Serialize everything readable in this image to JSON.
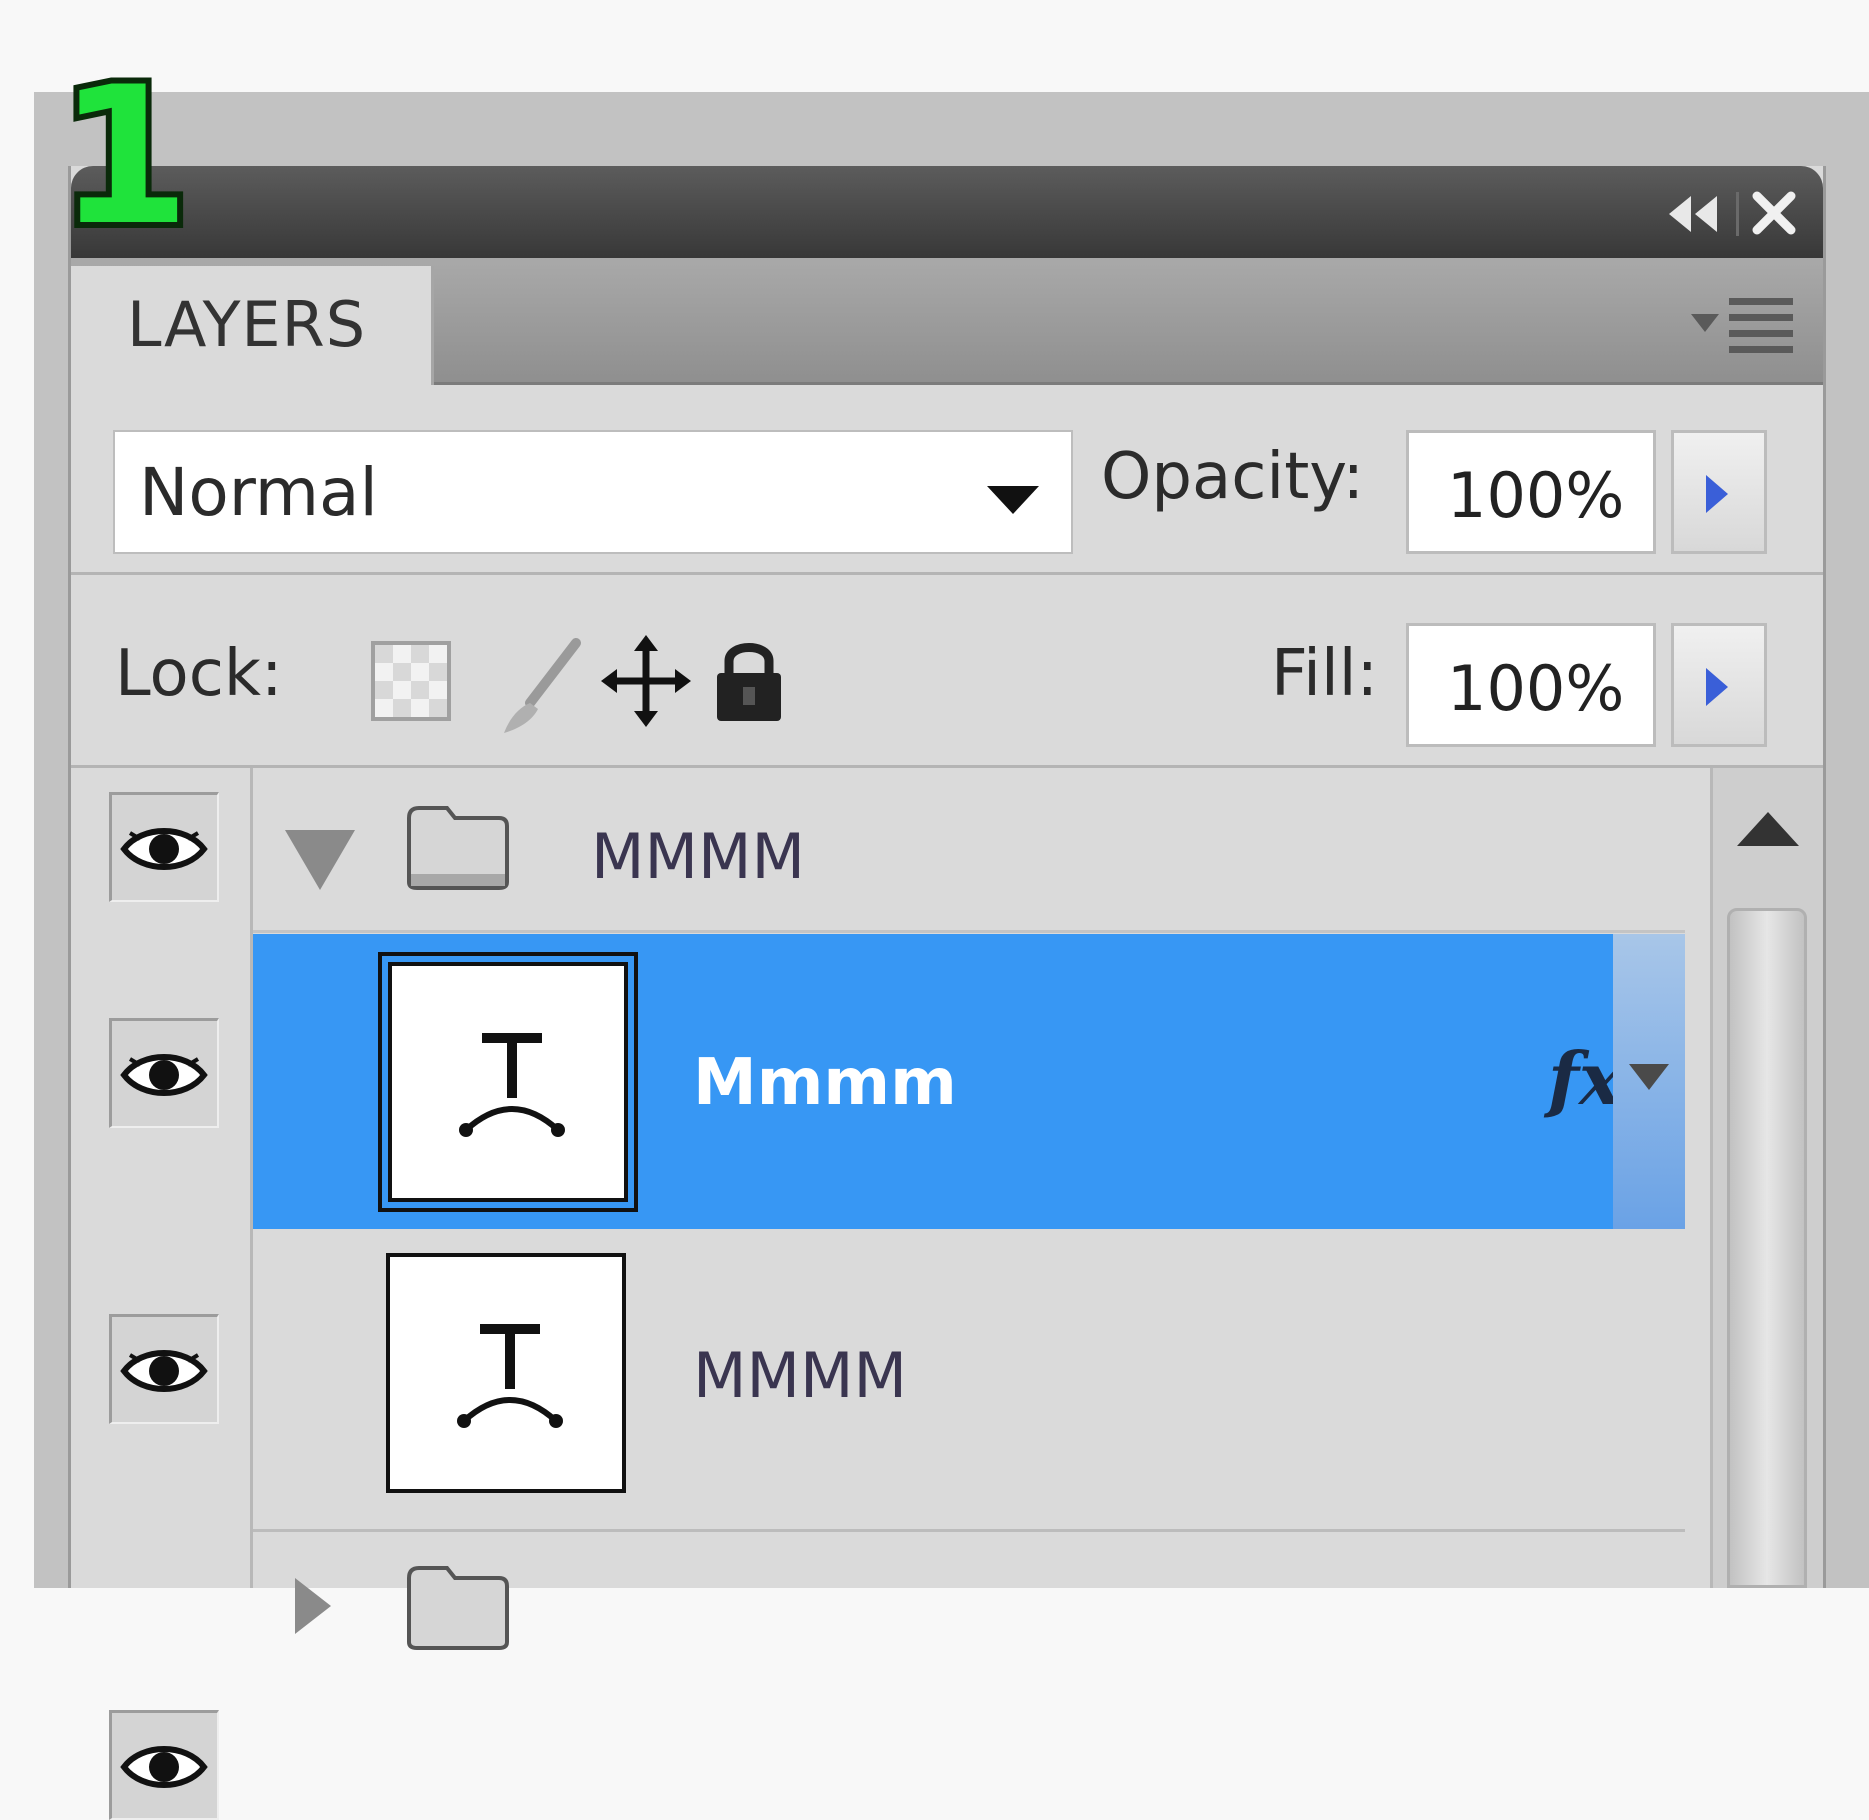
{
  "annotation": {
    "step_number": "1"
  },
  "panel": {
    "tab_label": "LAYERS",
    "blend_mode": {
      "selected": "Normal"
    },
    "opacity": {
      "label": "Opacity:",
      "value": "100%"
    },
    "lock": {
      "label": "Lock:"
    },
    "fill": {
      "label": "Fill:",
      "value": "100%"
    }
  },
  "layers": {
    "group": {
      "name": "MMMM",
      "expanded": true,
      "visible": true
    },
    "items": [
      {
        "name": "Mmmm",
        "type": "text",
        "selected": true,
        "visible": true,
        "has_effects": true,
        "effects_label": "fx"
      },
      {
        "name": "MMMM",
        "type": "text",
        "selected": false,
        "visible": true
      }
    ],
    "next_group": {
      "visible": true
    }
  },
  "colors": {
    "selection": "#3797f4",
    "badge_fill": "#1fe33b",
    "title_bar": "#444444",
    "panel_bg": "#dadada"
  },
  "icons": {
    "collapse": "double-chevron-left-icon",
    "close": "close-icon",
    "panel_menu": "panel-menu-icon",
    "eye": "eye-icon",
    "folder": "folder-icon",
    "text_layer": "text-layer-icon",
    "lock_transparency": "lock-transparency-icon",
    "lock_image": "lock-image-brush-icon",
    "lock_position": "lock-position-move-icon",
    "lock_all": "lock-all-padlock-icon"
  }
}
